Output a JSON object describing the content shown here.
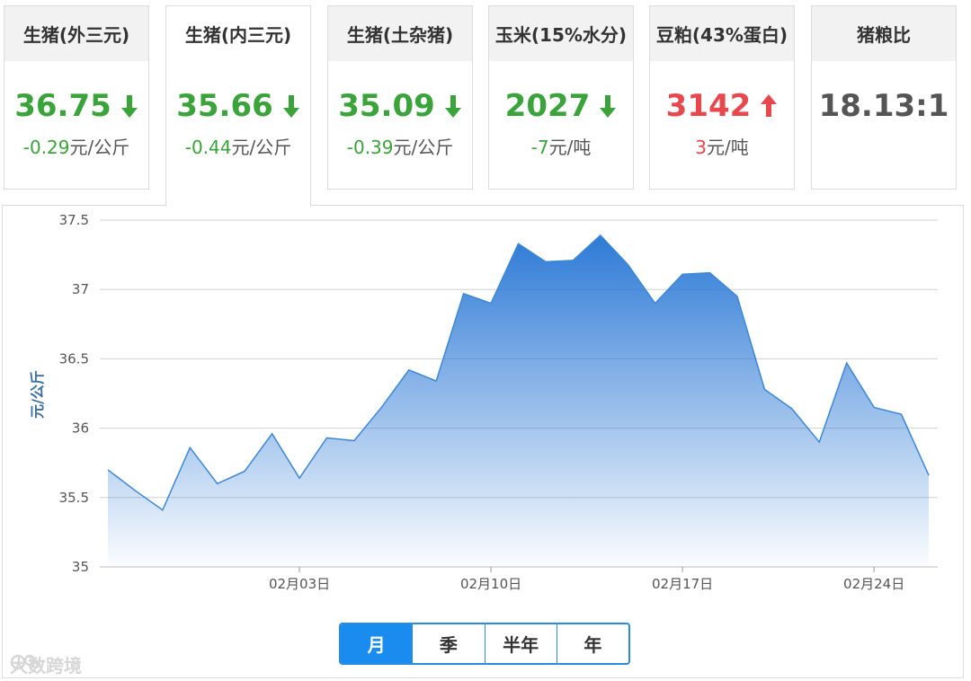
{
  "cards": [
    {
      "title": "生猪(外三元)",
      "value": "36.75",
      "direction": "down",
      "change": "-0.29",
      "unit": "元/公斤",
      "active": false
    },
    {
      "title": "生猪(内三元)",
      "value": "35.66",
      "direction": "down",
      "change": "-0.44",
      "unit": "元/公斤",
      "active": true
    },
    {
      "title": "生猪(土杂猪)",
      "value": "35.09",
      "direction": "down",
      "change": "-0.39",
      "unit": "元/公斤",
      "active": false
    },
    {
      "title": "玉米(15%水分)",
      "value": "2027",
      "direction": "down",
      "change": "-7",
      "unit": "元/吨",
      "active": false
    },
    {
      "title": "豆粕(43%蛋白)",
      "value": "3142",
      "direction": "up",
      "change": "3",
      "unit": "元/吨",
      "active": false
    },
    {
      "title": "猪粮比",
      "value": "18.13:1",
      "direction": "none",
      "change": "",
      "unit": "",
      "active": false
    }
  ],
  "colors": {
    "down": "#3aa33a",
    "up": "#e8474c",
    "line": "#3c87d6",
    "accent": "#1a8cf0"
  },
  "chart_data": {
    "type": "area",
    "ylabel": "元/公斤",
    "ylim": [
      35,
      37.5
    ],
    "yticks": [
      "35",
      "35.5",
      "36",
      "36.5",
      "37",
      "37.5"
    ],
    "xticks": [
      "02月03日",
      "02月10日",
      "02月17日",
      "02月24日"
    ],
    "xtick_index": [
      7,
      14,
      21,
      28
    ],
    "x_start_date": "2021-01-27",
    "values": [
      35.7,
      35.55,
      35.41,
      35.86,
      35.6,
      35.69,
      35.96,
      35.64,
      35.93,
      35.91,
      36.15,
      36.42,
      36.34,
      36.97,
      36.9,
      37.33,
      37.2,
      37.21,
      37.39,
      37.18,
      36.9,
      37.11,
      37.12,
      36.95,
      36.28,
      36.14,
      35.9,
      36.47,
      36.15,
      36.1,
      35.66
    ],
    "grid": true
  },
  "periods": {
    "items": [
      "月",
      "季",
      "半年",
      "年"
    ],
    "selected": "月"
  },
  "watermark": "大数跨境"
}
